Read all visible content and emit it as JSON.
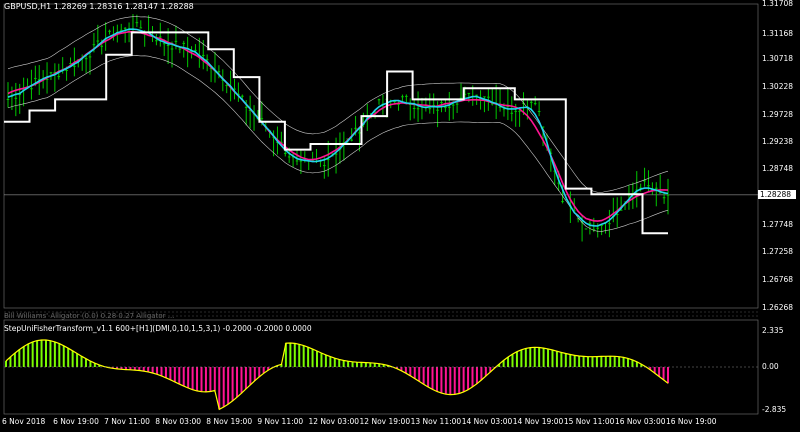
{
  "main_title": "GBPUSD,H1  1.28269 1.28316 1.28147 1.28288",
  "indicator_strip": "Bill Williams' Alligator (0.0) 0.28  0.27  Alligator ...",
  "indicator_title": "StepUniFisherTransform_v1.1 600+[H1](DMI,0,10,1,5,3,1) -0.2000 -0.2000 0.0000",
  "price_axis": [
    "1.31708",
    "1.31168",
    "1.30718",
    "1.30228",
    "1.29728",
    "1.29238",
    "1.28748",
    "1.28288",
    "1.27748",
    "1.27258",
    "1.26768",
    "1.26268"
  ],
  "price_current": "1.28288",
  "indicator_axis": [
    "2.335",
    "0.00",
    "-2.835"
  ],
  "time_axis": [
    "6 Nov 2018",
    "6 Nov 19:00",
    "7 Nov 11:00",
    "8 Nov 03:00",
    "8 Nov 19:00",
    "9 Nov 11:00",
    "12 Nov 03:00",
    "12 Nov 19:00",
    "13 Nov 11:00",
    "14 Nov 03:00",
    "14 Nov 19:00",
    "15 Nov 11:00",
    "16 Nov 03:00",
    "16 Nov 19:00"
  ],
  "chart_data": {
    "type": "line",
    "title": "GBPUSD,H1",
    "ylim": [
      1.2626,
      1.3171
    ],
    "series": [
      {
        "name": "white step line",
        "values": [
          1.296,
          1.298,
          1.3,
          1.3,
          1.308,
          1.312,
          1.312,
          1.312,
          1.309,
          1.304,
          1.296,
          1.291,
          1.292,
          1.292,
          1.297,
          1.305,
          1.3,
          1.3,
          1.302,
          1.302,
          1.3,
          1.3,
          1.284,
          1.283,
          1.283,
          1.276
        ]
      },
      {
        "name": "close",
        "values": [
          1.3,
          1.303,
          1.305,
          1.308,
          1.312,
          1.313,
          1.31,
          1.309,
          1.305,
          1.299,
          1.294,
          1.288,
          1.289,
          1.293,
          1.299,
          1.3,
          1.298,
          1.3,
          1.301,
          1.298,
          1.3,
          1.282,
          1.277,
          1.279,
          1.285,
          1.282
        ]
      }
    ],
    "colors": {
      "background": "#000000",
      "candles": "#00c800",
      "ma_cyan": "#22d3ee",
      "ma_magenta": "#ff1493",
      "step": "#ffffff",
      "hist_pos": "#7cfc00",
      "hist_neg": "#ff1493",
      "fisher": "#ffff00"
    }
  }
}
